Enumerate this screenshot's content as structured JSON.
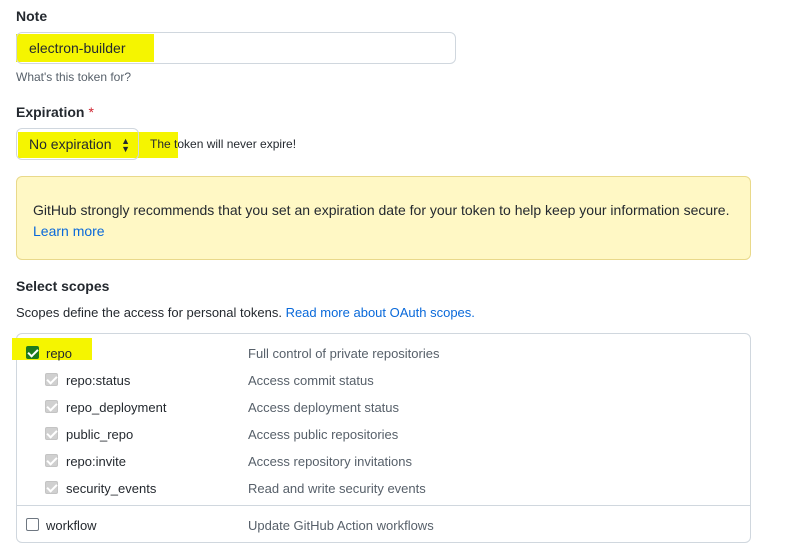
{
  "note": {
    "label": "Note",
    "value": "electron-builder",
    "help": "What's this token for?"
  },
  "expiration": {
    "label": "Expiration",
    "required_mark": "*",
    "selected": "No expiration",
    "note": "The token will never expire!"
  },
  "warning": {
    "text": "GitHub strongly recommends that you set an expiration date for your token to help keep your information secure.",
    "link": "Learn more"
  },
  "scopes": {
    "title": "Select scopes",
    "description": "Scopes define the access for personal tokens.",
    "link": "Read more about OAuth scopes.",
    "items": [
      {
        "name": "repo",
        "description": "Full control of private repositories",
        "checked": true
      },
      {
        "name": "repo:status",
        "description": "Access commit status",
        "checked": true
      },
      {
        "name": "repo_deployment",
        "description": "Access deployment status",
        "checked": true
      },
      {
        "name": "public_repo",
        "description": "Access public repositories",
        "checked": true
      },
      {
        "name": "repo:invite",
        "description": "Access repository invitations",
        "checked": true
      },
      {
        "name": "security_events",
        "description": "Read and write security events",
        "checked": true
      },
      {
        "name": "workflow",
        "description": "Update GitHub Action workflows",
        "checked": false
      }
    ]
  },
  "colors": {
    "highlight": "#f5f500",
    "link": "#0969da",
    "flash_bg": "#fff8c5",
    "checkbox_checked": "#1f6feb"
  }
}
